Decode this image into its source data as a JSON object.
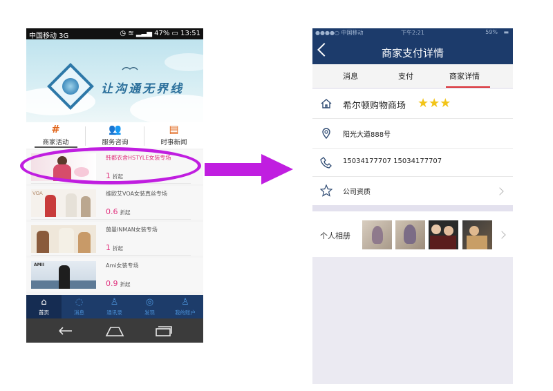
{
  "left_phone": {
    "status_bar": {
      "carrier": "中国移动 3G",
      "battery": "47%",
      "time": "13:51"
    },
    "banner": {
      "slogan": "让沟通无界线"
    },
    "quick_nav": [
      {
        "label": "商家活动",
        "icon": "grid-hash-icon"
      },
      {
        "label": "服务咨询",
        "icon": "people-icon"
      },
      {
        "label": "时事新闻",
        "icon": "news-doc-icon"
      }
    ],
    "merchants": [
      {
        "name": "韩都衣舍HSTYLE女装专场",
        "discount": "1",
        "unit": "折起"
      },
      {
        "name": "维欧艾VOA女装真丝专场",
        "discount": "0.6",
        "unit": "折起"
      },
      {
        "name": "茵曼INMAN女装专场",
        "discount": "1",
        "unit": "折起"
      },
      {
        "name": "Ami女装专场",
        "discount": "0.9",
        "unit": "折起"
      }
    ],
    "tabbar": [
      {
        "label": "首页",
        "icon": "home-icon",
        "active": true
      },
      {
        "label": "消息",
        "icon": "chat-icon",
        "active": false
      },
      {
        "label": "通讯录",
        "icon": "contacts-icon",
        "active": false
      },
      {
        "label": "发现",
        "icon": "discover-icon",
        "active": false
      },
      {
        "label": "我的账户",
        "icon": "user-icon",
        "active": false
      }
    ]
  },
  "right_phone": {
    "status_bar": {
      "carrier": "●●●●○ 中国移动",
      "time": "下午2:21",
      "battery": "59%"
    },
    "header": {
      "title": "商家支付详情"
    },
    "subtabs": [
      {
        "label": "消息",
        "active": false
      },
      {
        "label": "支付",
        "active": false
      },
      {
        "label": "商家详情",
        "active": true
      }
    ],
    "merchant": {
      "name": "希尔顿购物商场",
      "rating": 3,
      "address": "阳光大道888号",
      "phone": "15034177707  15034177707",
      "qualification_label": "公司资质"
    },
    "album": {
      "label": "个人相册",
      "photo_count": 4
    }
  },
  "colors": {
    "accent_magenta": "#c01ee0",
    "navy": "#1c3b6b",
    "discount_pink": "#e0317d",
    "star_gold": "#f2c418",
    "tab_underline_red": "#d8282f"
  }
}
